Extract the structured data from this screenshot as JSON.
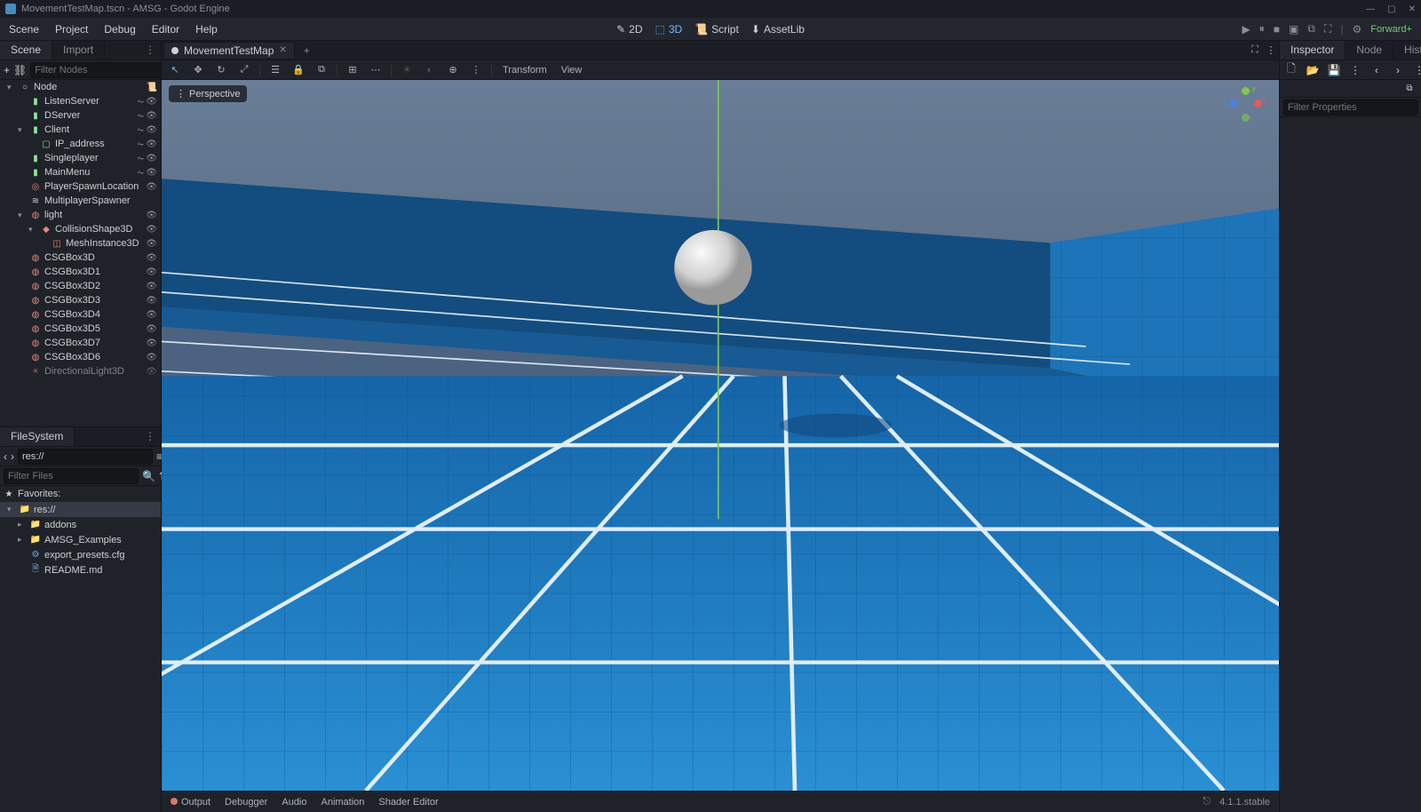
{
  "title": "MovementTestMap.tscn - AMSG - Godot Engine",
  "menubar": [
    "Scene",
    "Project",
    "Debug",
    "Editor",
    "Help"
  ],
  "modes": {
    "d2": "2D",
    "d3": "3D",
    "script": "Script",
    "assetlib": "AssetLib",
    "active": "d3"
  },
  "render_label": "Forward+",
  "scene_dock": {
    "tabs": [
      "Scene",
      "Import"
    ],
    "active_tab": "Scene",
    "filter_placeholder": "Filter Nodes",
    "tree": [
      {
        "ind": 0,
        "tog": "▾",
        "ico": "○",
        "col": "#cdd0d5",
        "lbl": "Node",
        "r": [
          "sc"
        ]
      },
      {
        "ind": 1,
        "ico": "▮",
        "col": "#8fe29a",
        "lbl": "ListenServer",
        "r": [
          "rs",
          "eye"
        ]
      },
      {
        "ind": 1,
        "ico": "▮",
        "col": "#8fe29a",
        "lbl": "DServer",
        "r": [
          "rs",
          "eye"
        ]
      },
      {
        "ind": 1,
        "tog": "▾",
        "ico": "▮",
        "col": "#8fe29a",
        "lbl": "Client",
        "r": [
          "rs",
          "eye"
        ]
      },
      {
        "ind": 2,
        "ico": "▢",
        "col": "#8fe29a",
        "lbl": "IP_address",
        "r": [
          "rs",
          "eye"
        ]
      },
      {
        "ind": 1,
        "ico": "▮",
        "col": "#8fe29a",
        "lbl": "Singleplayer",
        "r": [
          "rs",
          "eye"
        ]
      },
      {
        "ind": 1,
        "ico": "▮",
        "col": "#8fe29a",
        "lbl": "MainMenu",
        "r": [
          "rs",
          "eye"
        ]
      },
      {
        "ind": 1,
        "ico": "◎",
        "col": "#e2897b",
        "lbl": "PlayerSpawnLocation",
        "r": [
          "eye"
        ]
      },
      {
        "ind": 1,
        "ico": "≋",
        "col": "#cdd0d5",
        "lbl": "MultiplayerSpawner",
        "r": []
      },
      {
        "ind": 1,
        "tog": "▾",
        "ico": "◍",
        "col": "#e2897b",
        "lbl": "light",
        "r": [
          "eye"
        ]
      },
      {
        "ind": 2,
        "tog": "▾",
        "ico": "◆",
        "col": "#e2897b",
        "lbl": "CollisionShape3D",
        "r": [
          "eye"
        ]
      },
      {
        "ind": 3,
        "ico": "◫",
        "col": "#e2897b",
        "lbl": "MeshInstance3D",
        "r": [
          "eye"
        ]
      },
      {
        "ind": 1,
        "ico": "◍",
        "col": "#e2897b",
        "lbl": "CSGBox3D",
        "r": [
          "eye"
        ]
      },
      {
        "ind": 1,
        "ico": "◍",
        "col": "#e2897b",
        "lbl": "CSGBox3D1",
        "r": [
          "eye"
        ]
      },
      {
        "ind": 1,
        "ico": "◍",
        "col": "#e2897b",
        "lbl": "CSGBox3D2",
        "r": [
          "eye"
        ]
      },
      {
        "ind": 1,
        "ico": "◍",
        "col": "#e2897b",
        "lbl": "CSGBox3D3",
        "r": [
          "eye"
        ]
      },
      {
        "ind": 1,
        "ico": "◍",
        "col": "#e2897b",
        "lbl": "CSGBox3D4",
        "r": [
          "eye"
        ]
      },
      {
        "ind": 1,
        "ico": "◍",
        "col": "#e2897b",
        "lbl": "CSGBox3D5",
        "r": [
          "eye"
        ]
      },
      {
        "ind": 1,
        "ico": "◍",
        "col": "#e2897b",
        "lbl": "CSGBox3D7",
        "r": [
          "eye"
        ]
      },
      {
        "ind": 1,
        "ico": "◍",
        "col": "#e2897b",
        "lbl": "CSGBox3D6",
        "r": [
          "eye"
        ]
      },
      {
        "ind": 1,
        "ico": "☀",
        "col": "#e2897b",
        "lbl": "DirectionalLight3D",
        "r": [
          "eye"
        ],
        "dim": true
      }
    ]
  },
  "filesystem": {
    "title": "FileSystem",
    "path": "res://",
    "filter_placeholder": "Filter Files",
    "favorites_label": "Favorites:",
    "tree": [
      {
        "ind": 0,
        "tog": "▾",
        "ico": "📁",
        "lbl": "res://",
        "sel": true
      },
      {
        "ind": 1,
        "tog": "▸",
        "ico": "📁",
        "lbl": "addons"
      },
      {
        "ind": 1,
        "tog": "▸",
        "ico": "📁",
        "lbl": "AMSG_Examples"
      },
      {
        "ind": 1,
        "ico": "⚙",
        "lbl": "export_presets.cfg"
      },
      {
        "ind": 1,
        "ico": "🗎",
        "lbl": "README.md"
      }
    ]
  },
  "scene_tab": {
    "name": "MovementTestMap",
    "dot": true
  },
  "viewport": {
    "perspective": "Perspective",
    "transform": "Transform",
    "view": "View"
  },
  "bottom_tabs": [
    "Output",
    "Debugger",
    "Audio",
    "Animation",
    "Shader Editor"
  ],
  "version": "4.1.1.stable",
  "inspector": {
    "tabs": [
      "Inspector",
      "Node",
      "History"
    ],
    "active_tab": "Inspector",
    "filter_placeholder": "Filter Properties"
  }
}
